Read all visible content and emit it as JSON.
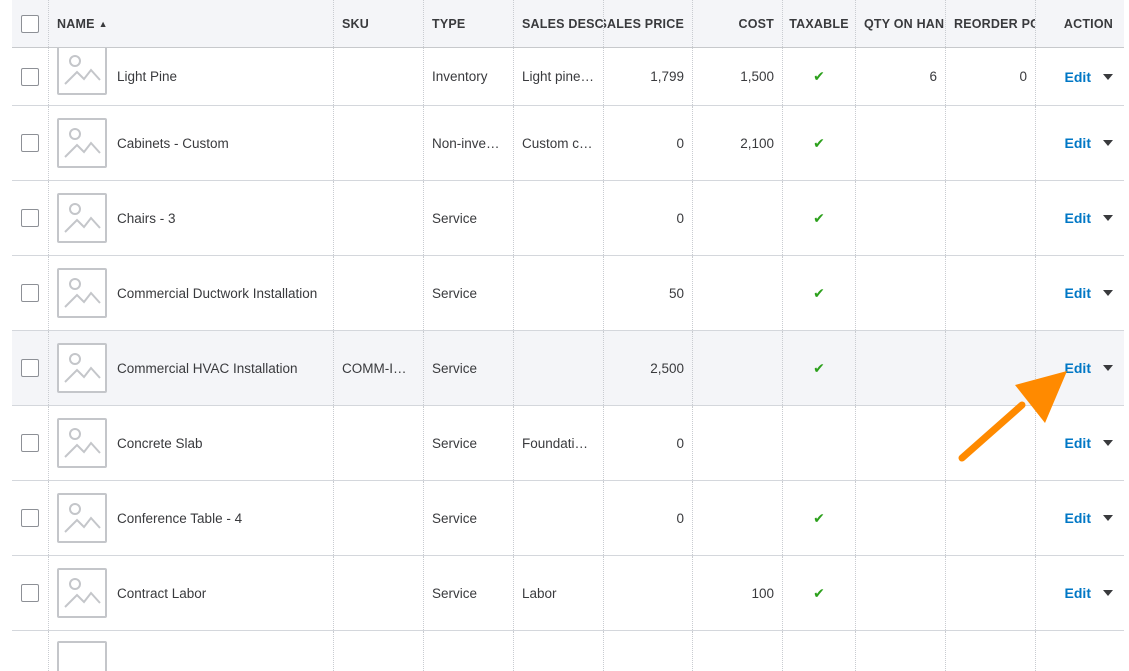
{
  "header": {
    "name": "NAME",
    "sort_indicator": "▲",
    "sku": "SKU",
    "type": "TYPE",
    "sales_desc": "SALES DESCR",
    "sales_price": "SALES PRICE",
    "cost": "COST",
    "taxable": "TAXABLE",
    "qty_on_hand": "QTY ON HAND",
    "reorder_point": "REORDER POI",
    "action": "ACTION"
  },
  "rows": [
    {
      "name": "Light Pine",
      "sku": "",
      "type": "Inventory",
      "desc": "Light pine…",
      "price": "1,799",
      "cost": "1,500",
      "taxable": "✔",
      "qty": "6",
      "reorder": "0",
      "action": "Edit"
    },
    {
      "name": "Cabinets - Custom",
      "sku": "",
      "type": "Non-inve…",
      "desc": "Custom c…",
      "price": "0",
      "cost": "2,100",
      "taxable": "✔",
      "qty": "",
      "reorder": "",
      "action": "Edit"
    },
    {
      "name": "Chairs - 3",
      "sku": "",
      "type": "Service",
      "desc": "",
      "price": "0",
      "cost": "",
      "taxable": "✔",
      "qty": "",
      "reorder": "",
      "action": "Edit"
    },
    {
      "name": "Commercial Ductwork Installation",
      "sku": "",
      "type": "Service",
      "desc": "",
      "price": "50",
      "cost": "",
      "taxable": "✔",
      "qty": "",
      "reorder": "",
      "action": "Edit"
    },
    {
      "name": "Commercial HVAC Installation",
      "sku": "COMM-I…",
      "type": "Service",
      "desc": "",
      "price": "2,500",
      "cost": "",
      "taxable": "✔",
      "qty": "",
      "reorder": "",
      "action": "Edit"
    },
    {
      "name": "Concrete Slab",
      "sku": "",
      "type": "Service",
      "desc": "Foundati…",
      "price": "0",
      "cost": "",
      "taxable": "",
      "qty": "",
      "reorder": "",
      "action": "Edit"
    },
    {
      "name": "Conference Table - 4",
      "sku": "",
      "type": "Service",
      "desc": "",
      "price": "0",
      "cost": "",
      "taxable": "✔",
      "qty": "",
      "reorder": "",
      "action": "Edit"
    },
    {
      "name": "Contract Labor",
      "sku": "",
      "type": "Service",
      "desc": "Labor",
      "price": "",
      "cost": "100",
      "taxable": "✔",
      "qty": "",
      "reorder": "",
      "action": "Edit"
    }
  ],
  "colors": {
    "link": "#0077c5",
    "check": "#2ca01c",
    "annotation_arrow": "#ff8a00",
    "row_highlight": "#f4f5f8"
  },
  "icons": {
    "sort": "sort-ascending-icon",
    "thumbnail": "image-placeholder-icon",
    "taxable": "checkmark-icon",
    "dropdown": "chevron-down-icon"
  }
}
